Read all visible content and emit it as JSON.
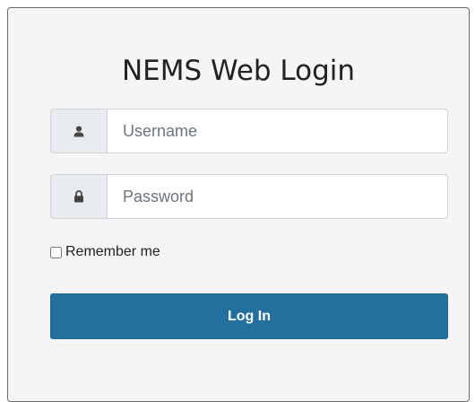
{
  "title": "NEMS Web Login",
  "username": {
    "placeholder": "Username",
    "value": "",
    "icon": "user-icon"
  },
  "password": {
    "placeholder": "Password",
    "value": "",
    "icon": "lock-icon"
  },
  "remember": {
    "label": "Remember me",
    "checked": false
  },
  "login_button": {
    "label": "Log In"
  },
  "colors": {
    "panel_bg": "#f5f5f5",
    "addon_bg": "#e9ecef",
    "button_bg": "#23709e",
    "button_text": "#ffffff"
  }
}
